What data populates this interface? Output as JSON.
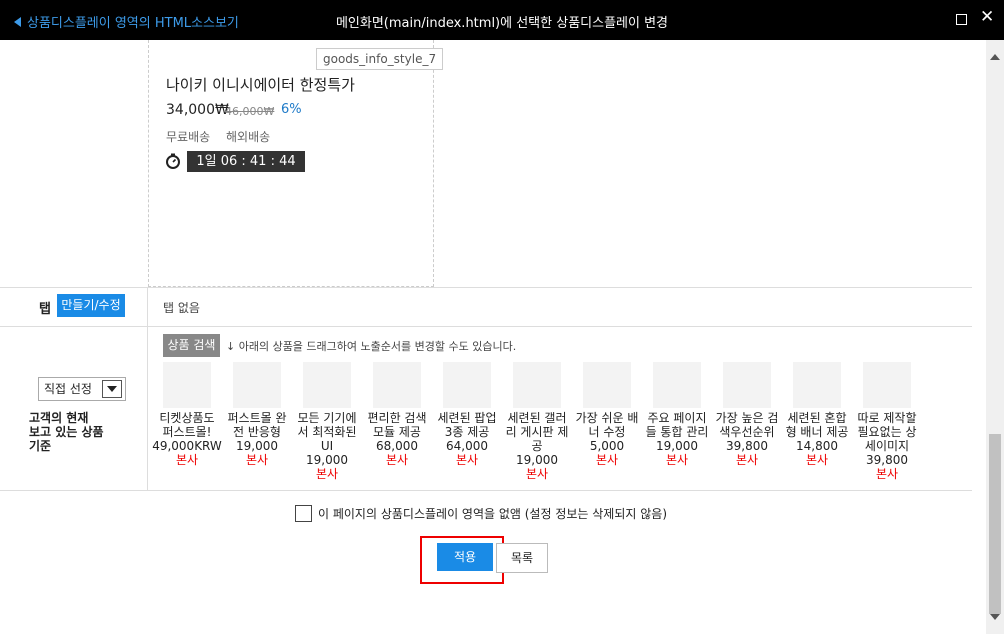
{
  "titlebar": {
    "back_label": "상품디스플레이 영역의 HTML소스보기",
    "title": "메인화면(main/index.html)에 선택한 상품디스플레이 변경"
  },
  "preview": {
    "style_label": "goods_info_style_7",
    "product_name": "나이키 이니시에이터 한정특가",
    "price": "34,000₩",
    "original_price": "46,000₩",
    "discount": "6%",
    "shipping": "무료배송",
    "overseas": "해외배송",
    "timer": "1일 06 : 41 : 44"
  },
  "tab_section": {
    "label": "탭",
    "button_label": "만들기/수정",
    "value": "탭 없음"
  },
  "product_section": {
    "select_value": "직접 선정",
    "criteria_lines": [
      "고객의 현재",
      "보고 있는 상품",
      "기준"
    ],
    "search_button": "상품 검색",
    "drag_hint": "↓ 아래의 상품을 드래그하여 노출순서를 변경할 수도 있습니다.",
    "items": [
      {
        "name": [
          "티켓상품도",
          "퍼스트몰!"
        ],
        "price": "49,000KRW",
        "seller": "본사"
      },
      {
        "name": [
          "퍼스트몰 완",
          "전 반응형"
        ],
        "price": "19,000",
        "seller": "본사"
      },
      {
        "name": [
          "모든 기기에",
          "서 최적화된",
          "UI"
        ],
        "price": "19,000",
        "seller": "본사"
      },
      {
        "name": [
          "편리한 검색",
          "모듈 제공"
        ],
        "price": "68,000",
        "seller": "본사"
      },
      {
        "name": [
          "세련된 팝업",
          "3종 제공"
        ],
        "price": "64,000",
        "seller": "본사"
      },
      {
        "name": [
          "세련된 갤러",
          "리 게시판 제",
          "공"
        ],
        "price": "19,000",
        "seller": "본사"
      },
      {
        "name": [
          "가장 쉬운 배",
          "너 수정"
        ],
        "price": "5,000",
        "seller": "본사"
      },
      {
        "name": [
          "주요 페이지",
          "들 통합 관리"
        ],
        "price": "19,000",
        "seller": "본사"
      },
      {
        "name": [
          "가장 높은 검",
          "색우선순위"
        ],
        "price": "39,800",
        "seller": "본사"
      },
      {
        "name": [
          "세련된 혼합",
          "형 배너 제공"
        ],
        "price": "14,800",
        "seller": "본사"
      },
      {
        "name": [
          "따로 제작할",
          "필요없는 상",
          "세이미지"
        ],
        "price": "39,800",
        "seller": "본사"
      }
    ]
  },
  "footer": {
    "checkbox_label": "이 페이지의 상품디스플레이 영역을 없앰 (설정 정보는 삭제되지 않음)",
    "apply_button": "적용",
    "list_button": "목록"
  }
}
